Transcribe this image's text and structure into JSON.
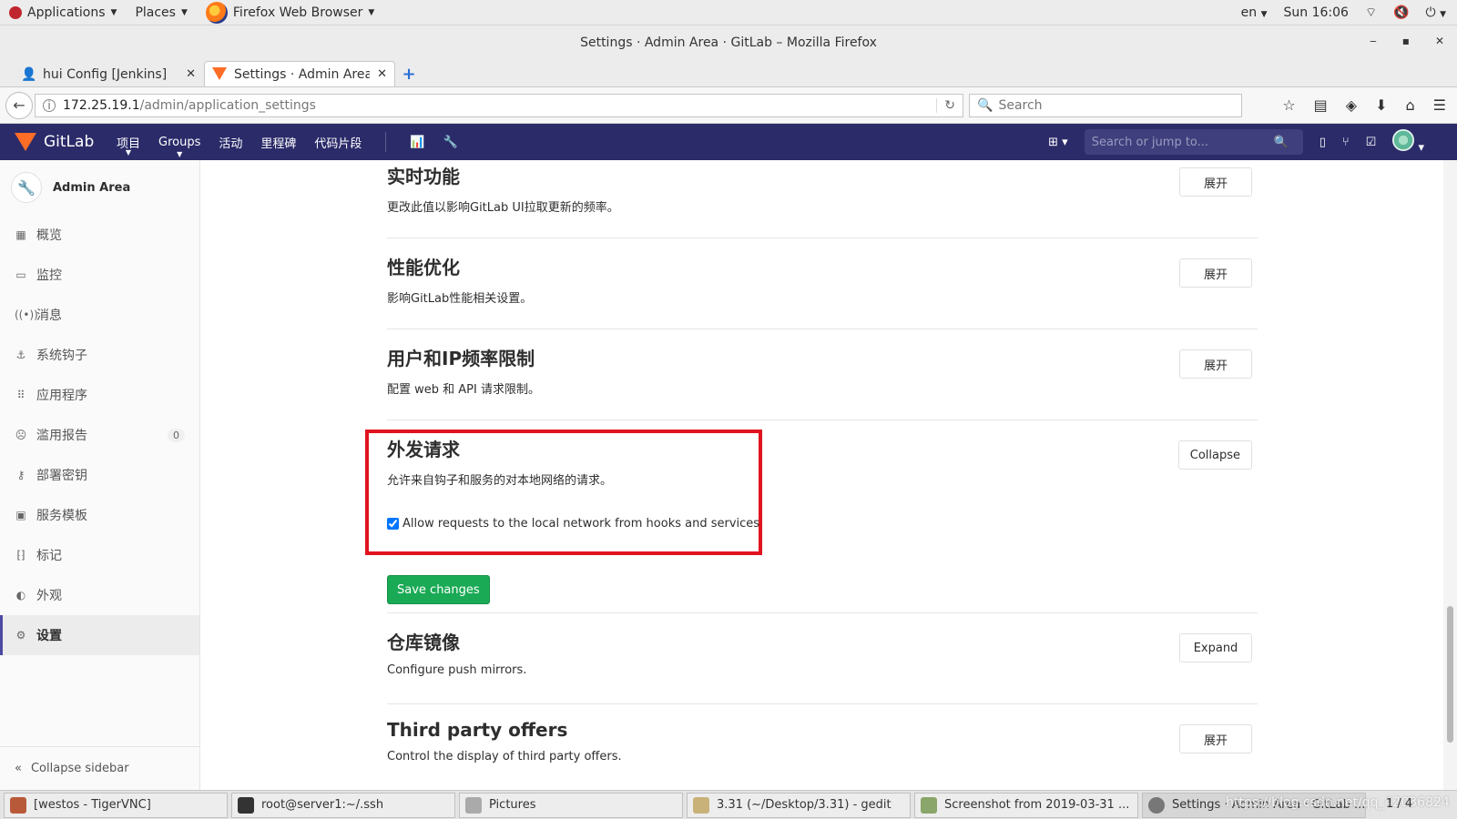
{
  "gnome": {
    "applications": "Applications",
    "places": "Places",
    "active_app": "Firefox Web Browser",
    "lang": "en",
    "clock": "Sun 16:06"
  },
  "window": {
    "title": "Settings · Admin Area · GitLab – Mozilla Firefox"
  },
  "tabs": [
    {
      "label": "hui Config [Jenkins]"
    },
    {
      "label": "Settings · Admin Area..."
    }
  ],
  "nav": {
    "url_host": "172.25.19.1",
    "url_path": "/admin/application_settings",
    "search_placeholder": "Search"
  },
  "gitlab": {
    "brand": "GitLab",
    "nav": [
      "项目",
      "Groups",
      "活动",
      "里程碑",
      "代码片段"
    ],
    "search_placeholder": "Search or jump to..."
  },
  "sidebar": {
    "title": "Admin Area",
    "items": [
      {
        "label": "概览"
      },
      {
        "label": "监控"
      },
      {
        "label": "消息"
      },
      {
        "label": "系统钩子"
      },
      {
        "label": "应用程序"
      },
      {
        "label": "滥用报告",
        "badge": "0"
      },
      {
        "label": "部署密钥"
      },
      {
        "label": "服务模板"
      },
      {
        "label": "标记"
      },
      {
        "label": "外观"
      },
      {
        "label": "设置"
      }
    ],
    "collapse": "Collapse sidebar"
  },
  "sections": [
    {
      "title": "实时功能",
      "desc": "更改此值以影响GitLab UI拉取更新的频率。",
      "button": "展开"
    },
    {
      "title": "性能优化",
      "desc": "影响GitLab性能相关设置。",
      "button": "展开"
    },
    {
      "title": "用户和IP频率限制",
      "desc": "配置 web 和 API 请求限制。",
      "button": "展开"
    },
    {
      "title": "外发请求",
      "desc": "允许来自钩子和服务的对本地网络的请求。",
      "button": "Collapse"
    },
    {
      "title": "仓库镜像",
      "desc": "Configure push mirrors.",
      "button": "Expand"
    },
    {
      "title": "Third party offers",
      "desc": "Control the display of third party offers.",
      "button": "展开"
    }
  ],
  "outbound": {
    "checkbox_label": "Allow requests to the local network from hooks and services",
    "checked": true,
    "save": "Save changes"
  },
  "taskbar": [
    {
      "label": "[westos - TigerVNC]"
    },
    {
      "label": "root@server1:~/.ssh"
    },
    {
      "label": "Pictures"
    },
    {
      "label": "3.31 (~/Desktop/3.31) - gedit"
    },
    {
      "label": "Screenshot from 2019-03-31 ..."
    },
    {
      "label": "Settings · Admin Area · GitLab ..."
    }
  ],
  "watermark": "https://blog.csdn.net/qq_42036824",
  "page_count": "1 / 4",
  "colors": {
    "gitlab_header": "#2b2b6a",
    "save_green": "#1aaa55",
    "highlight_red": "#e0141f"
  }
}
